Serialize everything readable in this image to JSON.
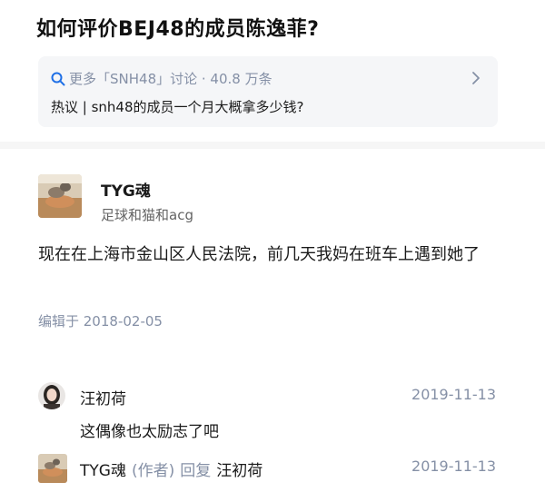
{
  "question": {
    "title": "如何评价BEJ48的成员陈逸菲?"
  },
  "topic_card": {
    "more_label": "更多「SNH48」讨论 · 40.8 万条",
    "hot_prefix": "热议 | ",
    "hot_text": "snh48的成员一个月大概拿多少钱?"
  },
  "answer": {
    "author_name": "TYG魂",
    "author_bio": "足球和猫和acg",
    "body": "现在在上海市金山区人民法院，前几天我妈在班车上遇到她了",
    "edit_time": "编辑于 2018-02-05"
  },
  "comment": {
    "author": "汪初荷",
    "time": "2019-11-13",
    "text": "这偶像也太励志了吧"
  },
  "reply": {
    "author": "TYG魂",
    "tag": "(作者)",
    "verb": "回复",
    "target": "汪初荷",
    "time": "2019-11-13"
  },
  "colors": {
    "meta_gray": "#8590a6",
    "card_bg": "#f5f6f8",
    "divider": "#f6f6f6"
  },
  "icons": [
    "search-icon",
    "chevron-right-icon"
  ]
}
